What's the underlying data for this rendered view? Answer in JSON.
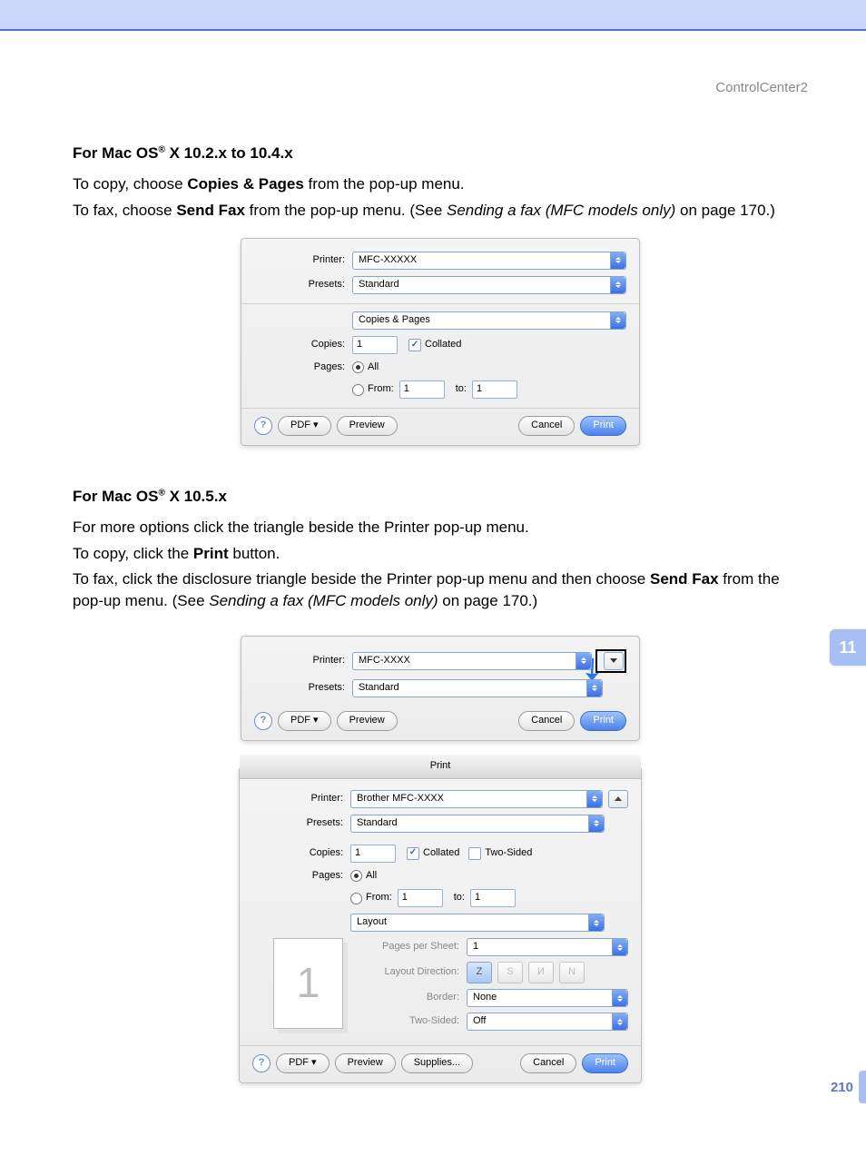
{
  "header": {
    "section": "ControlCenter2"
  },
  "chapter": "11",
  "page_number": "210",
  "section1": {
    "title_pre": "For Mac OS",
    "title_post": " X 10.2.x to 10.4.x",
    "p1_a": "To copy, choose ",
    "p1_b": "Copies & Pages",
    "p1_c": " from the pop-up menu.",
    "p2_a": "To fax, choose ",
    "p2_b": "Send Fax",
    "p2_c": " from the pop-up menu. (See ",
    "p2_d": "Sending a fax (MFC models only)",
    "p2_e": " on page 170.)"
  },
  "section2": {
    "title_pre": "For Mac OS",
    "title_post": " X 10.5.x",
    "p1": "For more options click the triangle beside the Printer pop-up menu.",
    "p2_a": "To copy, click the ",
    "p2_b": "Print",
    "p2_c": " button.",
    "p3_a": "To fax, click the disclosure triangle beside the Printer pop-up menu and then choose ",
    "p3_b": "Send Fax",
    "p3_c": " from the pop-up menu. (See ",
    "p3_d": "Sending a fax (MFC models only)",
    "p3_e": " on page 170.)"
  },
  "dialog1": {
    "labels": {
      "printer": "Printer:",
      "presets": "Presets:",
      "copies": "Copies:",
      "pages": "Pages:",
      "from": "From:",
      "to": "to:"
    },
    "printer_value": "MFC-XXXXX",
    "presets_value": "Standard",
    "menu_value": "Copies & Pages",
    "copies_value": "1",
    "collated": "Collated",
    "pages_all": "All",
    "from_value": "1",
    "to_value": "1",
    "pdf": "PDF ▾",
    "preview": "Preview",
    "cancel": "Cancel",
    "print": "Print"
  },
  "dialog2": {
    "printer_value": "MFC-XXXX",
    "presets_value": "Standard",
    "pdf": "PDF ▾",
    "preview": "Preview",
    "cancel": "Cancel",
    "print": "Print"
  },
  "dialog3": {
    "title": "Print",
    "printer_value": "Brother MFC-XXXX",
    "presets_value": "Standard",
    "copies_value": "1",
    "collated": "Collated",
    "twosided_chk": "Two-Sided",
    "pages_all": "All",
    "from": "From:",
    "to": "to:",
    "from_value": "1",
    "to_value": "1",
    "menu_value": "Layout",
    "pps": "Pages per Sheet:",
    "pps_value": "1",
    "layout_dir": "Layout Direction:",
    "border": "Border:",
    "border_value": "None",
    "two_sided": "Two-Sided:",
    "two_sided_value": "Off",
    "thumb": "1",
    "pdf": "PDF ▾",
    "preview": "Preview",
    "supplies": "Supplies...",
    "cancel": "Cancel",
    "print": "Print"
  }
}
